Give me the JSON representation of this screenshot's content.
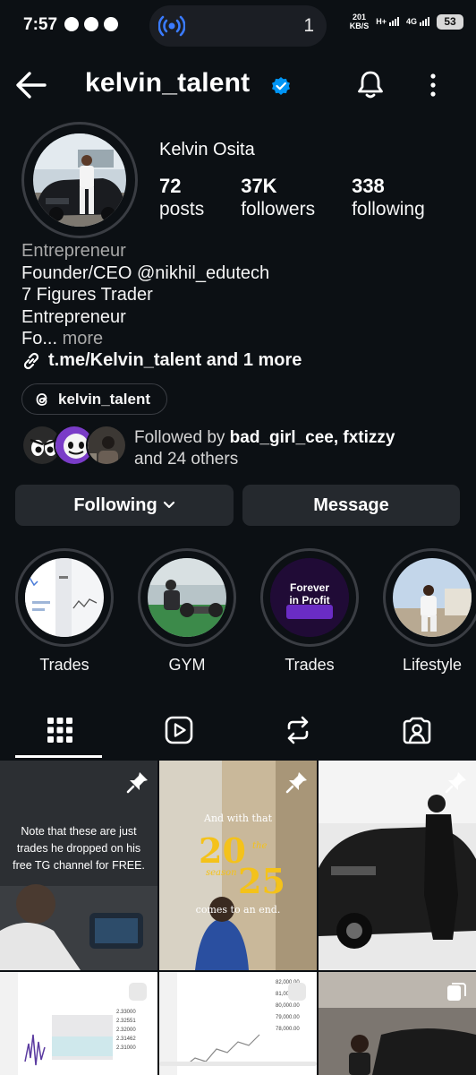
{
  "status_bar": {
    "time": "7:57",
    "island_count": "1",
    "speed_value": "201",
    "speed_unit": "KB/S",
    "net1": "H+",
    "net2": "4G",
    "battery": "53"
  },
  "header": {
    "username": "kelvin_talent",
    "icons": [
      "back-arrow-icon",
      "verified-badge-icon",
      "bell-icon",
      "more-vertical-icon"
    ]
  },
  "profile": {
    "full_name": "Kelvin Osita",
    "stats": [
      {
        "value": "72",
        "label": "posts"
      },
      {
        "value": "37K",
        "label": "followers"
      },
      {
        "value": "338",
        "label": "following"
      }
    ]
  },
  "bio": {
    "category": "Entrepreneur",
    "lines": [
      "Founder/CEO @nikhil_edutech",
      "7 Figures Trader",
      "Entrepreneur"
    ],
    "truncated": "Fo...",
    "more": "more",
    "link": "t.me/Kelvin_talent and 1 more"
  },
  "threads": {
    "label": "kelvin_talent"
  },
  "followed_by": {
    "prefix": "Followed by ",
    "names": "bad_girl_cee, fxtizzy",
    "suffix": "and 24 others"
  },
  "buttons": {
    "following": "Following",
    "message": "Message"
  },
  "highlights": [
    {
      "label": "Trades"
    },
    {
      "label": "GYM"
    },
    {
      "label": "Trades",
      "cover_text_1": "Forever",
      "cover_text_2": "in Profit"
    },
    {
      "label": "Lifestyle"
    }
  ],
  "tabs": [
    "grid-icon",
    "reels-icon",
    "reposts-icon",
    "tagged-icon"
  ],
  "posts": {
    "p1_text": "Note that these are just trades he dropped on his free TG channel for FREE.",
    "p2_line1": "And with that",
    "p2_year_a": "20",
    "p2_the": "the",
    "p2_season": "season",
    "p2_year_b": "25",
    "p2_line2": "comes to an end.",
    "p5_ticks": [
      "2.33000",
      "2.32551",
      "2.32000",
      "2.31462",
      "2.31000"
    ],
    "p6_ticks": [
      "82,000.00",
      "81,000.00",
      "80,000.00",
      "79,000.00",
      "78,000.00"
    ]
  },
  "colors": {
    "background": "#0c1014",
    "button": "#25292e",
    "verified": "#0095f6",
    "island_icon": "#3a7bff"
  }
}
